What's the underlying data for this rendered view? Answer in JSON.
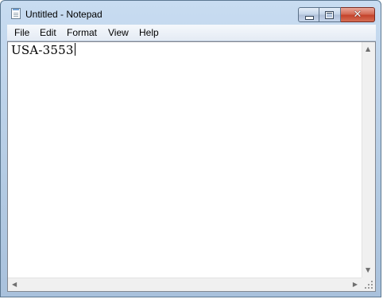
{
  "window": {
    "title": "Untitled - Notepad",
    "icon": "notepad-icon",
    "controls": {
      "minimize_icon": "minimize-icon",
      "maximize_icon": "maximize-icon",
      "close_glyph": "✕"
    }
  },
  "menubar": {
    "items": [
      {
        "label": "File"
      },
      {
        "label": "Edit"
      },
      {
        "label": "Format"
      },
      {
        "label": "View"
      },
      {
        "label": "Help"
      }
    ]
  },
  "editor": {
    "content": "USA-3553"
  },
  "scrollbars": {
    "up_arrow": "▲",
    "down_arrow": "▼",
    "left_arrow": "◀",
    "right_arrow": "▶"
  },
  "colors": {
    "titlebar": "#b4cbe3",
    "close_button": "#c4432c"
  }
}
